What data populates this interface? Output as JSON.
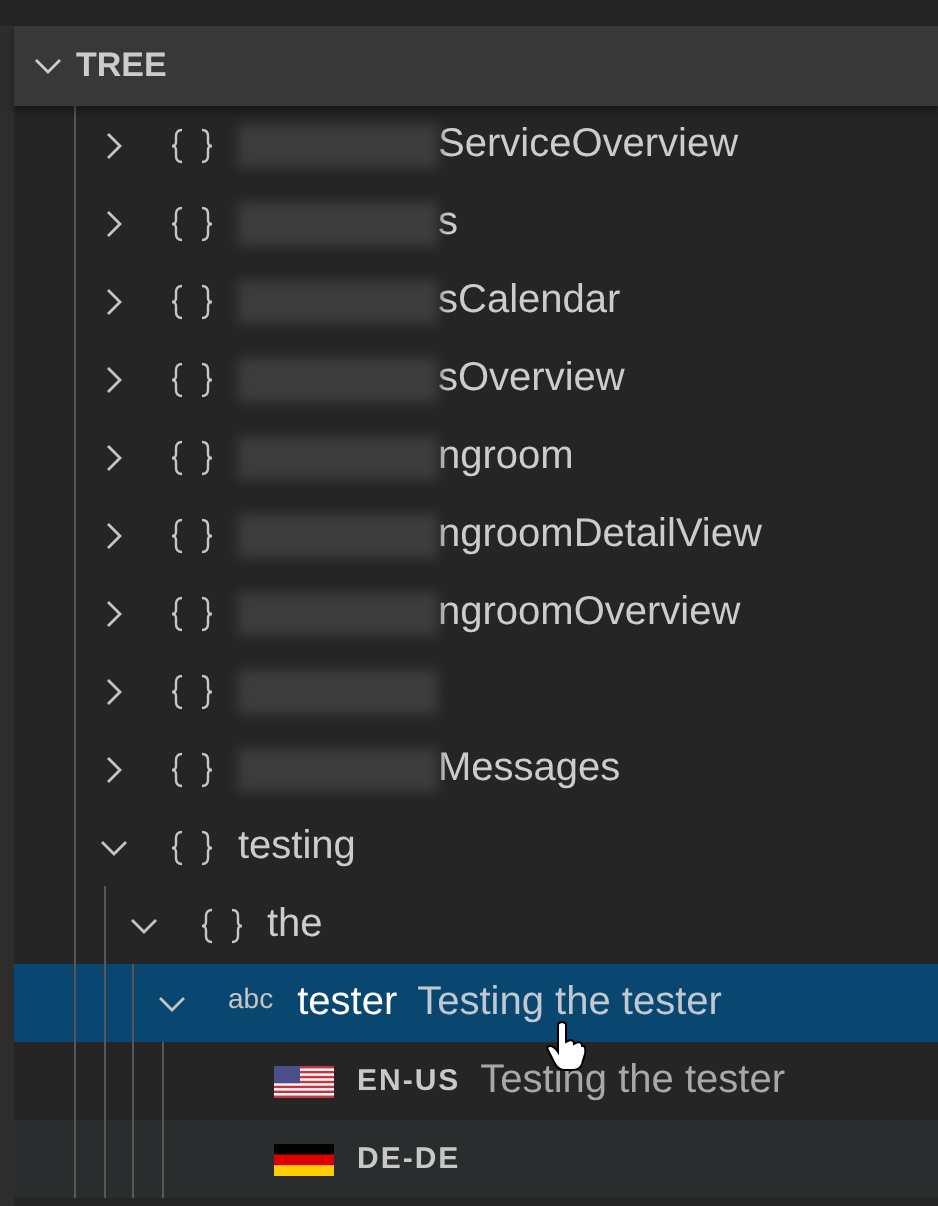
{
  "panel": {
    "title": "TREE",
    "expanded": true
  },
  "tree": [
    {
      "kind": "namespace",
      "redacted": true,
      "label": "ServiceOverview",
      "expanded": false
    },
    {
      "kind": "namespace",
      "redacted": true,
      "label": "s",
      "expanded": false
    },
    {
      "kind": "namespace",
      "redacted": true,
      "label": "sCalendar",
      "expanded": false
    },
    {
      "kind": "namespace",
      "redacted": true,
      "label": "sOverview",
      "expanded": false
    },
    {
      "kind": "namespace",
      "redacted": true,
      "label": "ngroom",
      "expanded": false
    },
    {
      "kind": "namespace",
      "redacted": true,
      "label": "ngroomDetailView",
      "expanded": false
    },
    {
      "kind": "namespace",
      "redacted": true,
      "label": "ngroomOverview",
      "expanded": false
    },
    {
      "kind": "namespace",
      "redacted": true,
      "expanded": false
    },
    {
      "kind": "namespace",
      "redacted": true,
      "label": "Messages",
      "expanded": false
    },
    {
      "kind": "namespace",
      "label": "testing",
      "expanded": true,
      "children": [
        {
          "kind": "namespace",
          "label": "the",
          "expanded": true,
          "children": [
            {
              "kind": "key",
              "icon_text": "abc",
              "label": "tester",
              "description": "Testing the tester",
              "expanded": true,
              "selected": true,
              "children": [
                {
                  "kind": "locale",
                  "icon": {
                    "kind": "us_flag"
                  },
                  "label": "EN-US",
                  "description": "Testing the tester",
                  "hovered": false
                },
                {
                  "kind": "locale",
                  "icon": {
                    "kind": "de_flag"
                  },
                  "label": "DE-DE",
                  "hovered": true
                }
              ]
            }
          ]
        }
      ]
    }
  ]
}
